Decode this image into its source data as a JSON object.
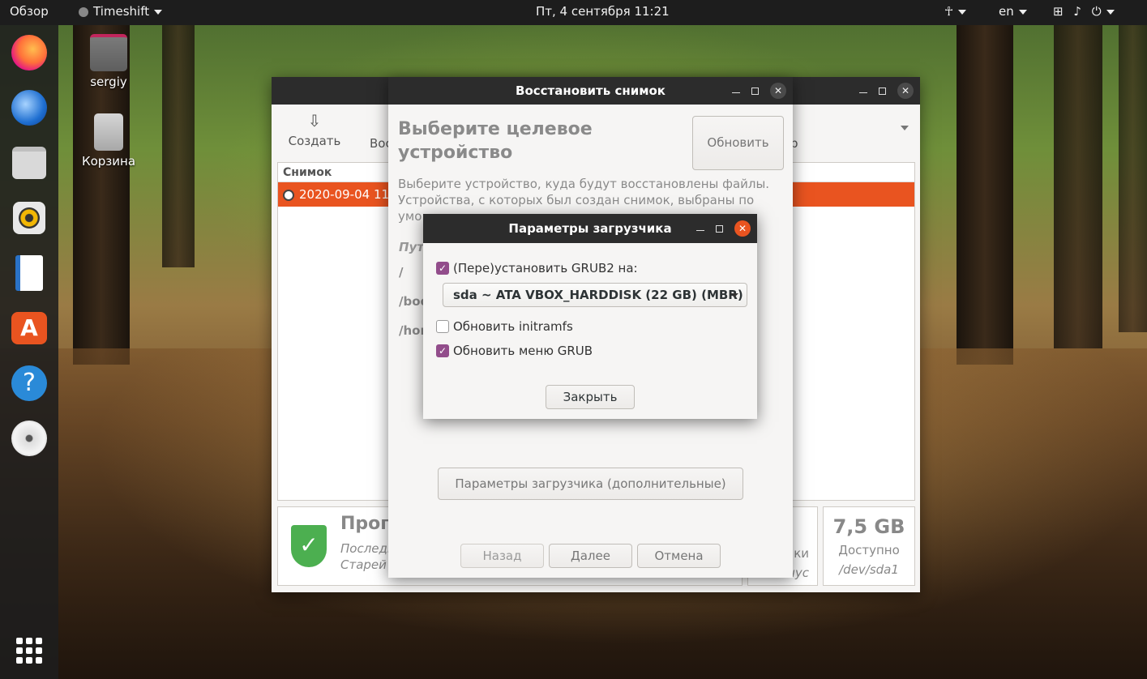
{
  "topbar": {
    "activities": "Обзор",
    "app_menu": "Timeshift",
    "clock": "Пт, 4 сентября  11:21",
    "lang": "en"
  },
  "desktop": {
    "home_label": "sergiy",
    "trash_label": "Корзина"
  },
  "main_window": {
    "toolbar_create": "Создать",
    "toolbar_restore_partial": "Вос",
    "toolbar_partial_right": "р",
    "list_header": "Снимок",
    "snapshot_row": "2020-09-04 11",
    "status_title_partial": "Прог",
    "status_line1_partial": "Последн",
    "status_line2_partial": "Старей",
    "partial_mid1": "ки",
    "partial_mid2": "чус",
    "available_size": "7,5 GB",
    "available_label": "Доступно",
    "available_device": "/dev/sda1"
  },
  "restore_window": {
    "title": "Восстановить снимок",
    "heading": "Выберите целевое устройство",
    "refresh_button": "Обновить",
    "desc_line1": "Выберите устройство, куда будут восстановлены файлы.",
    "desc_line2": "Устройства, с которых был создан снимок, выбраны по",
    "desc_line3_partial": "умо",
    "col_path_partial": "Пут",
    "path_root": "/",
    "path_boot_partial": "/boo",
    "path_home_partial": "/hor",
    "bootloader_advanced_button": "Параметры загрузчика (дополнительные)",
    "back_button": "Назад",
    "next_button": "Далее",
    "cancel_button": "Отмена"
  },
  "bootloader_dialog": {
    "title": "Параметры загрузчика",
    "grub_install_label": "(Пере)установить GRUB2 на:",
    "grub_install_checked": true,
    "device_select_value": "sda ~ ATA VBOX_HARDDISK (22 GB) (MBR)",
    "initramfs_label": "Обновить initramfs",
    "initramfs_checked": false,
    "grub_menu_label": "Обновить меню GRUB",
    "grub_menu_checked": true,
    "close_button": "Закрыть"
  },
  "colors": {
    "accent_orange": "#e95420",
    "checkbox_purple": "#924d8b",
    "titlebar_dark": "#2c2c2c",
    "shield_green": "#4caf50"
  }
}
